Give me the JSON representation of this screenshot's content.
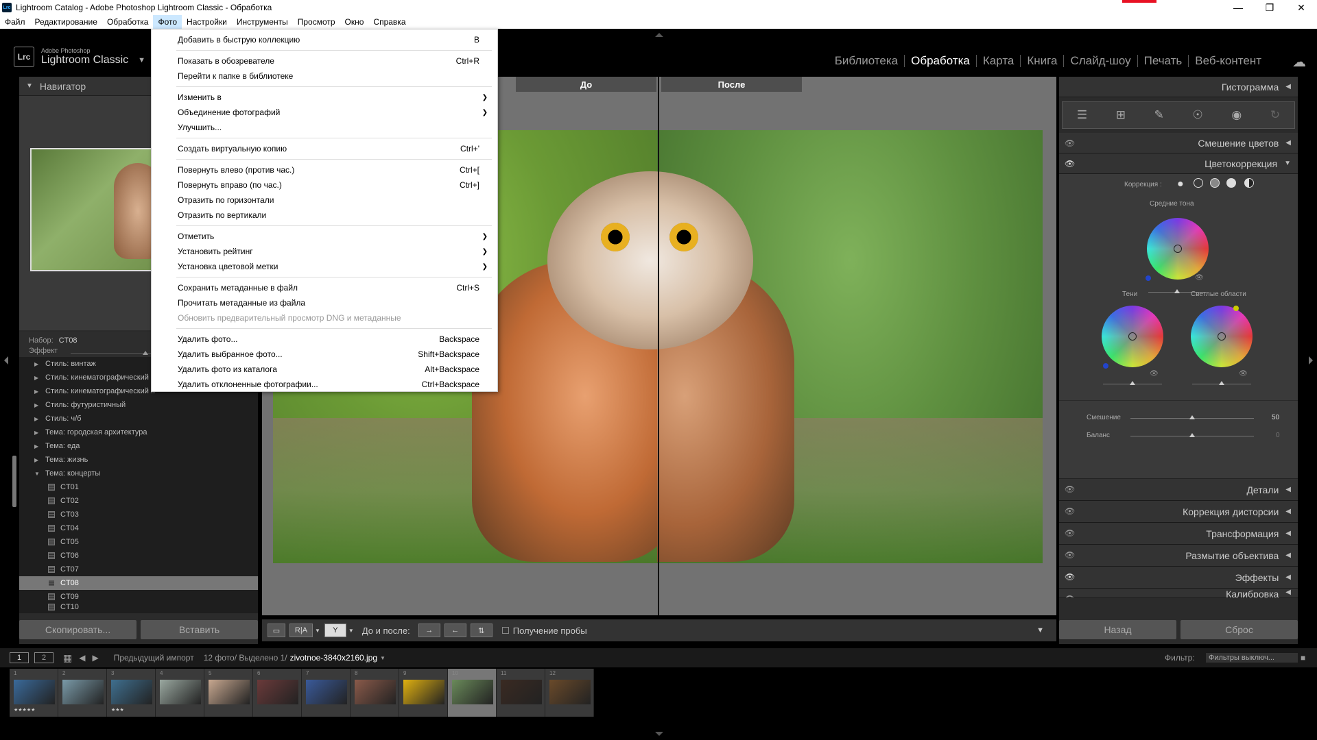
{
  "window": {
    "title": "Lightroom Catalog - Adobe Photoshop Lightroom Classic - Обработка",
    "icon": "Lrc"
  },
  "menubar": [
    "Файл",
    "Редактирование",
    "Обработка",
    "Фото",
    "Настройки",
    "Инструменты",
    "Просмотр",
    "Окно",
    "Справка"
  ],
  "logo": {
    "line1": "Adobe Photoshop",
    "line2": "Lightroom Classic",
    "badge": "Lrc"
  },
  "modules": [
    "Библиотека",
    "Обработка",
    "Карта",
    "Книга",
    "Слайд-шоу",
    "Печать",
    "Веб-контент"
  ],
  "left": {
    "navigator_title": "Навигатор",
    "set_label": "Набор:",
    "set_value": "CT08",
    "effect_label": "Эффект",
    "tree": [
      "Стиль: винтаж",
      "Стиль: кинематографический",
      "Стиль: кинематографический II",
      "Стиль: футуристичный",
      "Стиль: ч/б",
      "Тема: городская архитектура",
      "Тема: еда",
      "Тема: жизнь",
      "Тема: концерты"
    ],
    "sub": [
      "CT01",
      "CT02",
      "CT03",
      "CT04",
      "CT05",
      "CT06",
      "CT07",
      "CT08",
      "CT09",
      "CT10"
    ],
    "copy_btn": "Скопировать...",
    "paste_btn": "Вставить"
  },
  "center": {
    "before": "До",
    "after": "После",
    "toolbar_label": "До и после:",
    "probe_label": "Получение пробы"
  },
  "right": {
    "histogram": "Гистограмма",
    "mixer": "Смешение цветов",
    "color_grading": "Цветокоррекция",
    "correction_label": "Коррекция :",
    "midtones": "Средние тона",
    "shadows": "Тени",
    "highlights": "Светлые области",
    "blend_label": "Смешение",
    "blend_value": "50",
    "balance_label": "Баланс",
    "balance_value": "0",
    "sections": [
      "Детали",
      "Коррекция дисторсии",
      "Трансформация",
      "Размытие объектива",
      "Эффекты",
      "Калибровка"
    ],
    "back_btn": "Назад",
    "reset_btn": "Сброс"
  },
  "filmbar": {
    "num1": "1",
    "num2": "2",
    "source": "Предыдущий импорт",
    "count": "12 фото/ Выделено 1/",
    "file": "zivotnoe-3840x2160.jpg",
    "filter_label": "Фильтр:",
    "filter_value": "Фильтры выключ..."
  },
  "thumbs": [
    {
      "n": "1",
      "color": "#3a6a9a",
      "stars": "★★★★★"
    },
    {
      "n": "2",
      "color": "#7a9aa8",
      "stars": ""
    },
    {
      "n": "3",
      "color": "#3f6f8f",
      "stars": "★★★"
    },
    {
      "n": "4",
      "color": "#9aa8a0",
      "stars": ""
    },
    {
      "n": "5",
      "color": "#c8a890",
      "stars": ""
    },
    {
      "n": "6",
      "color": "#6a3a3a",
      "stars": ""
    },
    {
      "n": "7",
      "color": "#3a5a9a",
      "stars": ""
    },
    {
      "n": "8",
      "color": "#8a5a4a",
      "stars": ""
    },
    {
      "n": "9",
      "color": "#e0b010",
      "stars": ""
    },
    {
      "n": "10",
      "color": "#6a8a5a",
      "stars": ""
    },
    {
      "n": "11",
      "color": "#3a2a22",
      "stars": ""
    },
    {
      "n": "12",
      "color": "#6a4a2a",
      "stars": ""
    }
  ],
  "dropdown": [
    {
      "label": "Добавить в быструю коллекцию",
      "shortcut": "B"
    },
    {
      "sep": true
    },
    {
      "label": "Показать в обозревателе",
      "shortcut": "Ctrl+R"
    },
    {
      "label": "Перейти к папке в библиотеке",
      "shortcut": ""
    },
    {
      "sep": true
    },
    {
      "label": "Изменить в",
      "arrow": true
    },
    {
      "label": "Объединение фотографий",
      "arrow": true
    },
    {
      "label": "Улучшить...",
      "shortcut": ""
    },
    {
      "sep": true
    },
    {
      "label": "Создать виртуальную копию",
      "shortcut": "Ctrl+'"
    },
    {
      "sep": true
    },
    {
      "label": "Повернуть влево (против час.)",
      "shortcut": "Ctrl+["
    },
    {
      "label": "Повернуть вправо (по час.)",
      "shortcut": "Ctrl+]"
    },
    {
      "label": "Отразить по горизонтали",
      "shortcut": ""
    },
    {
      "label": "Отразить по вертикали",
      "shortcut": ""
    },
    {
      "sep": true
    },
    {
      "label": "Отметить",
      "arrow": true
    },
    {
      "label": "Установить рейтинг",
      "arrow": true
    },
    {
      "label": "Установка цветовой метки",
      "arrow": true
    },
    {
      "sep": true
    },
    {
      "label": "Сохранить метаданные в файл",
      "shortcut": "Ctrl+S"
    },
    {
      "label": "Прочитать метаданные из файла",
      "shortcut": ""
    },
    {
      "label": "Обновить предварительный просмотр DNG и метаданные",
      "shortcut": "",
      "disabled": true
    },
    {
      "sep": true
    },
    {
      "label": "Удалить фото...",
      "shortcut": "Backspace"
    },
    {
      "label": "Удалить выбранное фото...",
      "shortcut": "Shift+Backspace"
    },
    {
      "label": "Удалить фото из каталога",
      "shortcut": "Alt+Backspace"
    },
    {
      "label": "Удалить отклоненные фотографии...",
      "shortcut": "Ctrl+Backspace"
    }
  ]
}
